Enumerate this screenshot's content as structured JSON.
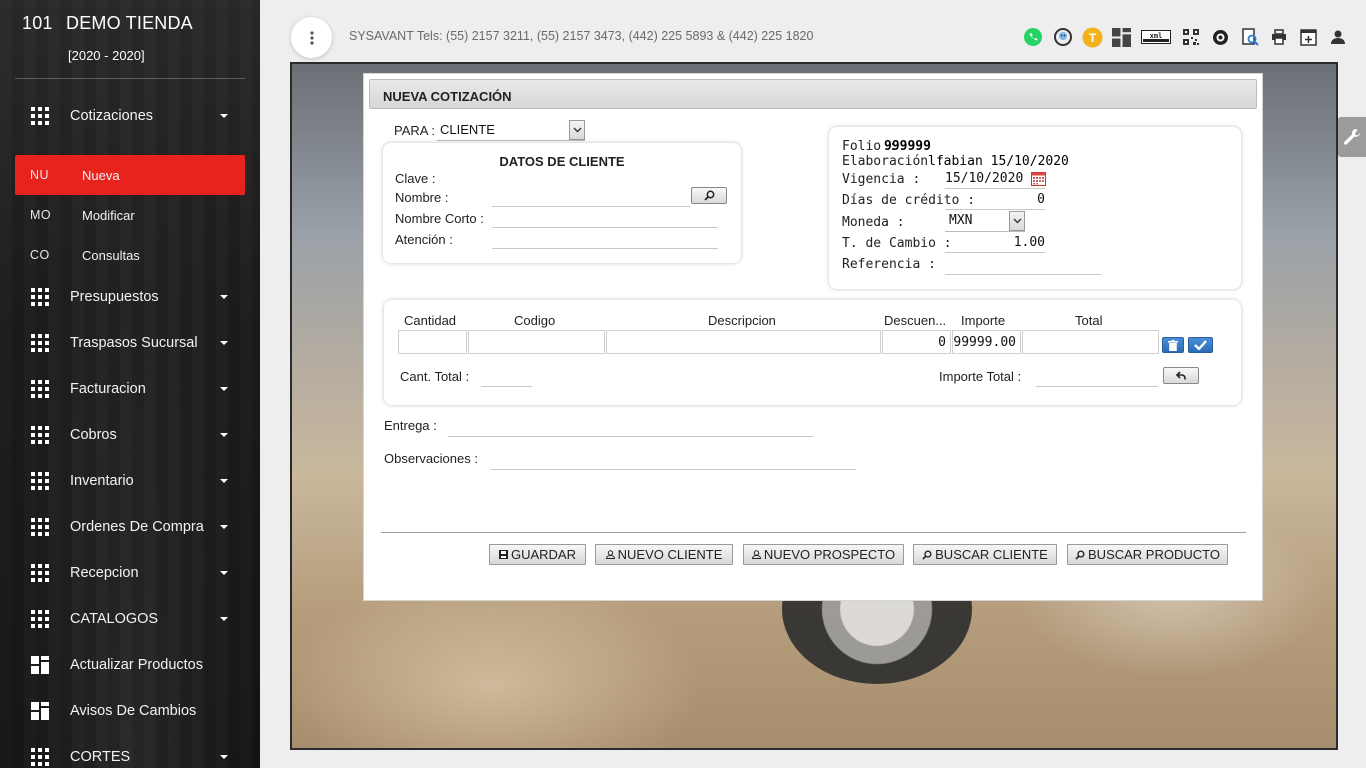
{
  "sidebar": {
    "store_number": "101",
    "store_name": "DEMO TIENDA",
    "years": "[2020 - 2020]",
    "items": [
      {
        "label": "Cotizaciones",
        "icon": "grid-icon"
      },
      {
        "label": "Presupuestos",
        "icon": "grid-icon"
      },
      {
        "label": "Traspasos Sucursal",
        "icon": "grid-icon"
      },
      {
        "label": "Facturacion",
        "icon": "grid-icon"
      },
      {
        "label": "Cobros",
        "icon": "grid-icon"
      },
      {
        "label": "Inventario",
        "icon": "grid-icon"
      },
      {
        "label": "Ordenes De Compra",
        "icon": "grid-icon"
      },
      {
        "label": "Recepcion",
        "icon": "grid-icon"
      },
      {
        "label": "CATALOGOS",
        "icon": "grid-icon"
      },
      {
        "label": "Actualizar Productos",
        "icon": "dashboard-icon"
      },
      {
        "label": "Avisos De Cambios",
        "icon": "dashboard-icon"
      },
      {
        "label": "CORTES",
        "icon": "grid-icon"
      }
    ],
    "subitems": [
      {
        "abbr": "NU",
        "label": "Nueva",
        "active": true
      },
      {
        "abbr": "MO",
        "label": "Modificar",
        "active": false
      },
      {
        "abbr": "CO",
        "label": "Consultas",
        "active": false
      }
    ]
  },
  "topbar": {
    "phones": "SYSAVANT Tels: (55) 2157 3211, (55) 2157 3473, (442) 225 5893 & (442) 225 1820",
    "icons": [
      "whatsapp-icon",
      "support-agent-icon",
      "t-badge-icon",
      "dashboard-icon",
      "xml-icon",
      "qr-code-icon",
      "tire-icon",
      "document-search-icon",
      "printer-icon",
      "add-window-icon",
      "user-icon"
    ],
    "t_badge": "T",
    "xml_label": "xml"
  },
  "form": {
    "title": "NUEVA COTIZACIÓN",
    "para_label": "PARA :",
    "para_value": "CLIENTE",
    "cliente": {
      "heading": "DATOS DE CLIENTE",
      "clave_label": "Clave :",
      "nombre_label": "Nombre :",
      "nombre_corto_label": "Nombre Corto :",
      "atencion_label": "Atención :"
    },
    "folio": {
      "folio_label": "Folio :",
      "folio_value": "999999",
      "elaboracion_label": "Elaboración :",
      "elaboracion_value": "lfabian 15/10/2020",
      "vigencia_label": "Vigencia :",
      "vigencia_value": "15/10/2020",
      "dias_label": "Días de crédito :",
      "dias_value": "0",
      "moneda_label": "Moneda :",
      "moneda_value": "MXN",
      "tcambio_label": "T. de Cambio :",
      "tcambio_value": "1.00",
      "referencia_label": "Referencia :"
    },
    "table": {
      "headers": [
        "Cantidad",
        "Codigo",
        "Descripcion",
        "Descuen...",
        "Importe",
        "Total"
      ],
      "row": {
        "cantidad": "",
        "codigo": "",
        "descripcion": "",
        "descuento": "0",
        "importe": "99999.00",
        "total": ""
      },
      "cant_total_label": "Cant. Total :",
      "importe_total_label": "Importe Total :"
    },
    "entrega_label": "Entrega :",
    "observaciones_label": "Observaciones :",
    "buttons": {
      "guardar": "GUARDAR",
      "nuevo_cliente": "NUEVO CLIENTE",
      "nuevo_prospecto": "NUEVO PROSPECTO",
      "buscar_cliente": "BUSCAR CLIENTE",
      "buscar_producto": "BUSCAR PRODUCTO"
    }
  },
  "colors": {
    "active_red": "#e8221c",
    "blue_button": "#2a6bb5",
    "sidebar_bg": "#1c1c1c"
  }
}
